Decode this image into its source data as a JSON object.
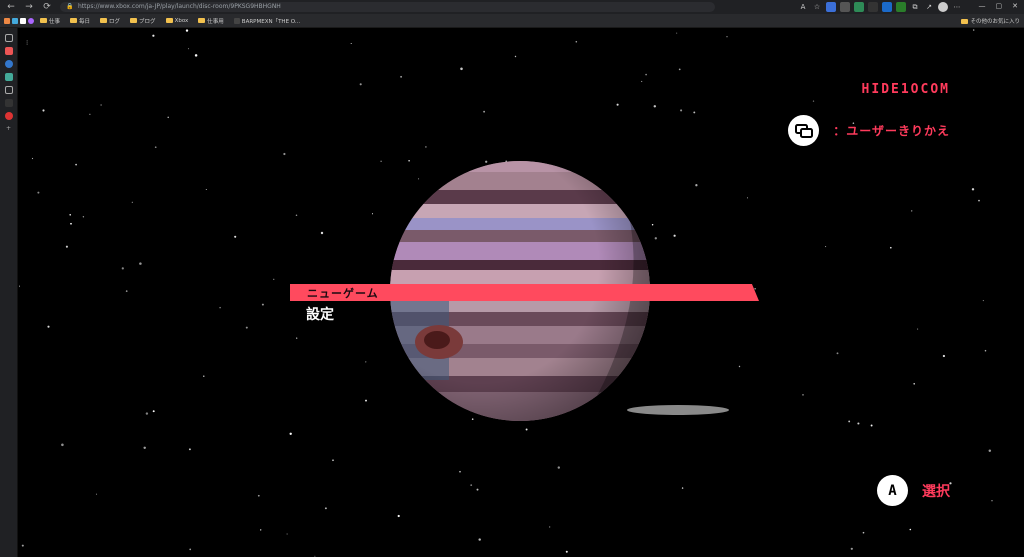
{
  "browser": {
    "url": "https://www.xbox.com/ja-JP/play/launch/disc-room/9PKSG9HBHGNH",
    "window_controls": [
      "—",
      "▢",
      "✕"
    ]
  },
  "bookmarks": {
    "items": [
      {
        "label": "仕事",
        "icon": "folder-icon"
      },
      {
        "label": "毎日",
        "icon": "folder-icon"
      },
      {
        "label": "ログ",
        "icon": "folder-icon"
      },
      {
        "label": "ブログ",
        "icon": "folder-icon"
      },
      {
        "label": "Xbox",
        "icon": "folder-icon"
      },
      {
        "label": "仕事用",
        "icon": "folder-icon"
      },
      {
        "label": "BARPMEXN「THE O...",
        "icon": "page-icon"
      }
    ],
    "other_label": "その他のお気に入り"
  },
  "game": {
    "profile_name": "HIDE1OCOM",
    "switch_user_label": "：ユーザーきりかえ",
    "menu": {
      "selected": "ニューゲーム",
      "second": "設定"
    },
    "select_button_glyph": "A",
    "select_label": "選択"
  },
  "colors": {
    "accent": "#ff3b5c",
    "menu_highlight": "#ff4a5e",
    "background": "#000000"
  }
}
